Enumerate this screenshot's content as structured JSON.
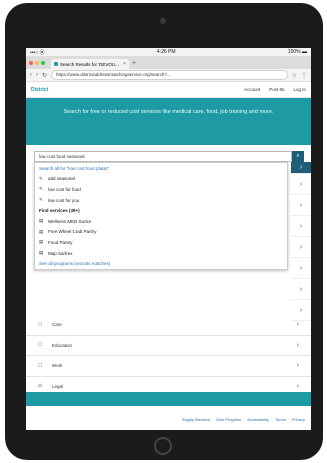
{
  "status_bar": {
    "left": "•••○ ⦿",
    "time": "4:26 PM",
    "right": "100% ▬"
  },
  "browser": {
    "tab_title": "Search Results for 'DEVOU...",
    "new_tab": "+",
    "url": "https://www.districtaddressmatchingservice.org/search?...",
    "nav_back": "‹",
    "nav_forward": "›",
    "reload": "↻"
  },
  "site": {
    "logo": "District",
    "nav": [
      "Account",
      "Post-Its",
      "Log In"
    ]
  },
  "hero": {
    "text": "Search for free or reduced cost services like medical care, food, job training and more."
  },
  "search": {
    "value": "low cost food seasonal"
  },
  "dropdown": {
    "items": [
      {
        "type": "link",
        "label": "Search all for \"low cost food (data)\""
      },
      {
        "type": "icon",
        "icon": "✎",
        "label": "add seasonal"
      },
      {
        "type": "icon",
        "icon": "✎",
        "label": "low cost for food"
      },
      {
        "type": "icon",
        "icon": "✎",
        "label": "low cost for you"
      },
      {
        "type": "head",
        "label": "Find services (39+)"
      },
      {
        "type": "icon",
        "icon": "▤",
        "label": "Wellness MED Sucke"
      },
      {
        "type": "icon",
        "icon": "▤",
        "label": "Free Wheel Crab Pantry"
      },
      {
        "type": "icon",
        "icon": "▤",
        "label": "Food Pantry"
      },
      {
        "type": "icon",
        "icon": "▤",
        "label": "Map Sarfrex"
      },
      {
        "type": "link",
        "label": "See all programs (recruits matches)"
      }
    ]
  },
  "side_chevrons": [
    "›",
    "›",
    "›",
    "›",
    "›",
    "›",
    "›",
    "›"
  ],
  "categories": [
    {
      "icon": "☖",
      "label": "Care"
    },
    {
      "icon": "☐",
      "label": "Education"
    },
    {
      "icon": "☐",
      "label": "Work"
    },
    {
      "icon": "⚖",
      "label": "Legal"
    }
  ],
  "footer": {
    "links": [
      "Supply Blended",
      "Give Progress",
      "Accessibility",
      "Terms",
      "Privacy"
    ]
  },
  "colors": {
    "brand": "#1e9aa5",
    "dark_accent": "#1e5e78",
    "link": "#2b6fb0"
  }
}
